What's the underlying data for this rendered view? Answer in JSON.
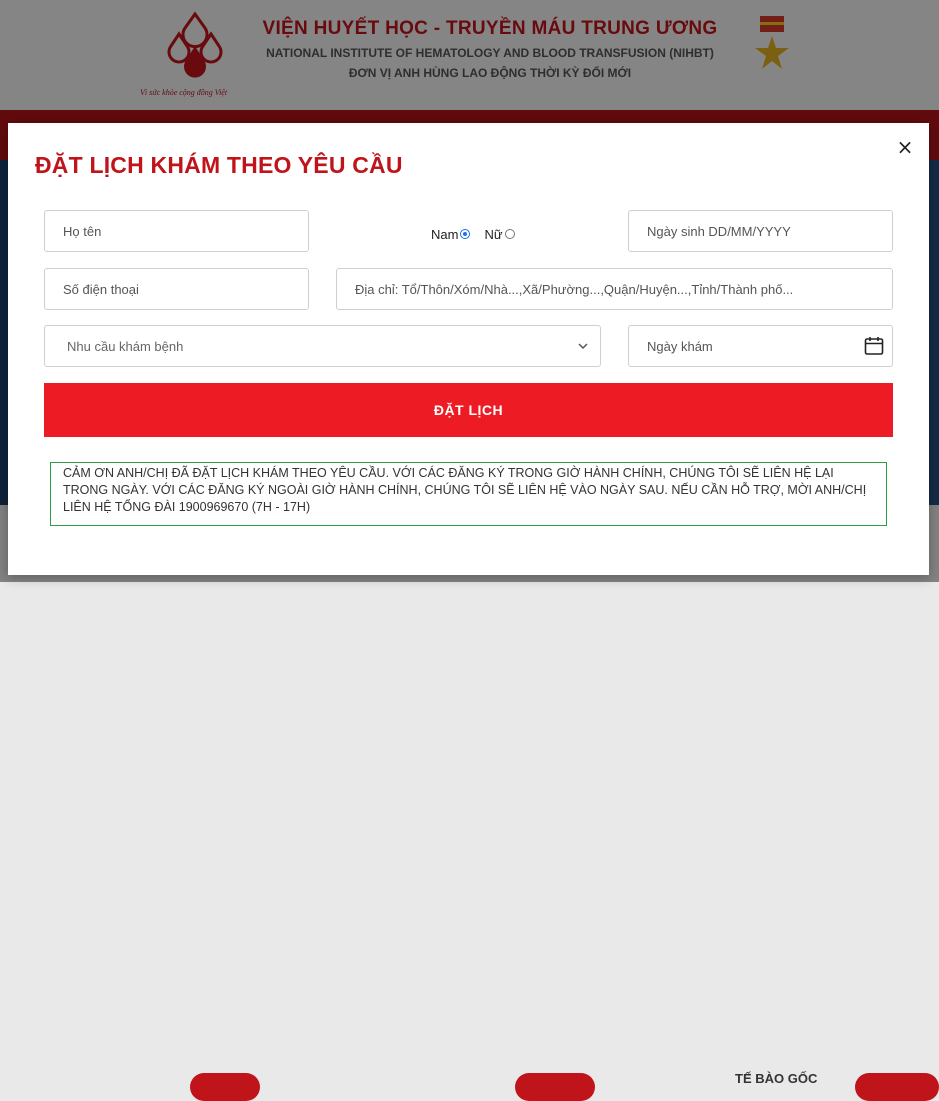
{
  "header": {
    "title_vi": "VIỆN HUYẾT HỌC - TRUYỀN MÁU TRUNG ƯƠNG",
    "title_en": "NATIONAL INSTITUTE OF HEMATOLOGY AND BLOOD TRANSFUSION (NIHBT)",
    "unit": "ĐƠN VỊ ANH HÙNG LAO ĐỘNG THỜI KỲ ĐỔI MỚI",
    "logo_caption": "Vì sức khỏe cộng đồng Việt",
    "medal_icon": "hero-medal-icon",
    "brand_color": "#c0141b"
  },
  "background": {
    "footer_partial_text": "TẾ BÀO GỐC"
  },
  "modal": {
    "title": "ĐẶT LỊCH KHÁM THEO YÊU CẦU",
    "close_label": "×",
    "fields": {
      "name_placeholder": "Họ tên",
      "gender_male_label": "Nam",
      "gender_female_label": "Nữ",
      "gender_selected": "Nam",
      "dob_placeholder": "Ngày sinh DD/MM/YYYY",
      "phone_placeholder": "Số điện thoại",
      "address_placeholder": "Địa chỉ: Tổ/Thôn/Xóm/Nhà...,Xã/Phường...,Quận/Huyện...,Tỉnh/Thành phố...",
      "need_placeholder": "Nhu cầu khám bệnh",
      "visit_date_placeholder": "Ngày khám"
    },
    "submit_label": "ĐẶT LỊCH",
    "submit_color": "#ed1c24",
    "notice": "CẢM ƠN ANH/CHỊ ĐÃ ĐẶT LỊCH KHÁM THEO YÊU CẦU. VỚI CÁC ĐĂNG KÝ TRONG GIỜ HÀNH CHÍNH, CHÚNG TÔI SẼ LIÊN HỆ LẠI TRONG NGÀY. VỚI CÁC ĐĂNG KÝ NGOÀI GIỜ HÀNH CHÍNH, CHÚNG TÔI SẼ LIÊN HỆ VÀO NGÀY SAU. NẾU CẦN HỖ TRỢ, MỜI ANH/CHỊ LIÊN HỆ TỔNG ĐÀI 1900969670 (7H - 17H)"
  }
}
